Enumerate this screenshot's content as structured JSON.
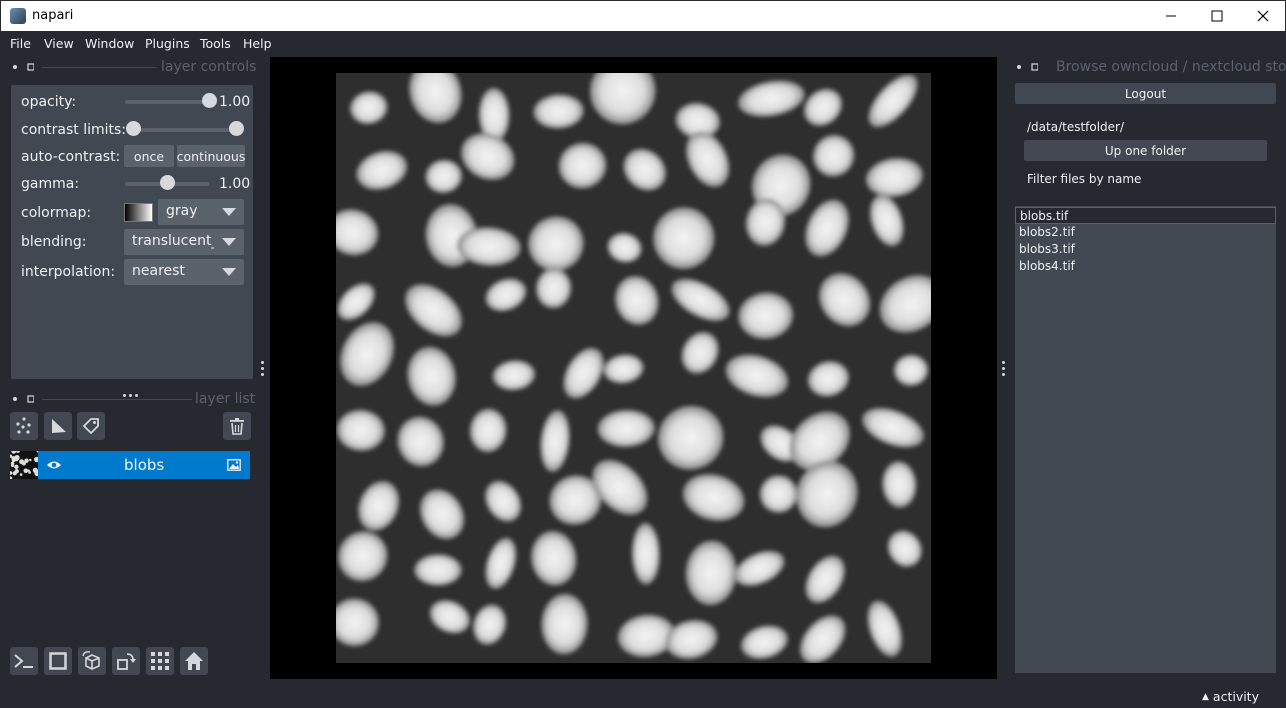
{
  "window": {
    "title": "napari"
  },
  "menubar": {
    "items": [
      "File",
      "View",
      "Window",
      "Plugins",
      "Tools",
      "Help"
    ]
  },
  "layer_controls": {
    "title": "layer controls",
    "opacity": {
      "label": "opacity:",
      "value": "1.00",
      "level": 1.0
    },
    "contrast": {
      "label": "contrast limits:",
      "low": 0.0,
      "high": 1.0
    },
    "auto_contrast": {
      "label": "auto-contrast:",
      "once": "once",
      "continuous": "continuous"
    },
    "gamma": {
      "label": "gamma:",
      "value": "1.00",
      "level": 0.5
    },
    "colormap": {
      "label": "colormap:",
      "value": "gray"
    },
    "blending": {
      "label": "blending:",
      "value": "translucent_"
    },
    "interpolation": {
      "label": "interpolation:",
      "value": "nearest"
    }
  },
  "layer_list": {
    "title": "layer list",
    "layers": [
      {
        "name": "blobs",
        "visible": true,
        "type": "image"
      }
    ]
  },
  "right_panel": {
    "title": "Browse owncloud / nextcloud stor",
    "logout": "Logout",
    "path": "/data/testfolder/",
    "up_folder": "Up one folder",
    "filter_placeholder": "Filter files by name",
    "files": [
      "blobs.tif",
      "blobs2.tif",
      "blobs3.tif",
      "blobs4.tif"
    ],
    "selected_file": "blobs.tif"
  },
  "status": {
    "activity": "activity"
  },
  "colors": {
    "accent": "#007acc",
    "background": "#262930",
    "panel": "#414851",
    "control": "#5a626c"
  },
  "icons": {
    "window": [
      "minimize-icon",
      "maximize-icon",
      "close-icon"
    ],
    "layer_tools": [
      "new-points-icon",
      "new-shapes-icon",
      "new-labels-icon",
      "delete-layer-icon"
    ],
    "bottom": [
      "console-icon",
      "ndisplay-2d-icon",
      "roll-dims-icon",
      "transpose-icon",
      "grid-icon",
      "home-icon"
    ]
  }
}
